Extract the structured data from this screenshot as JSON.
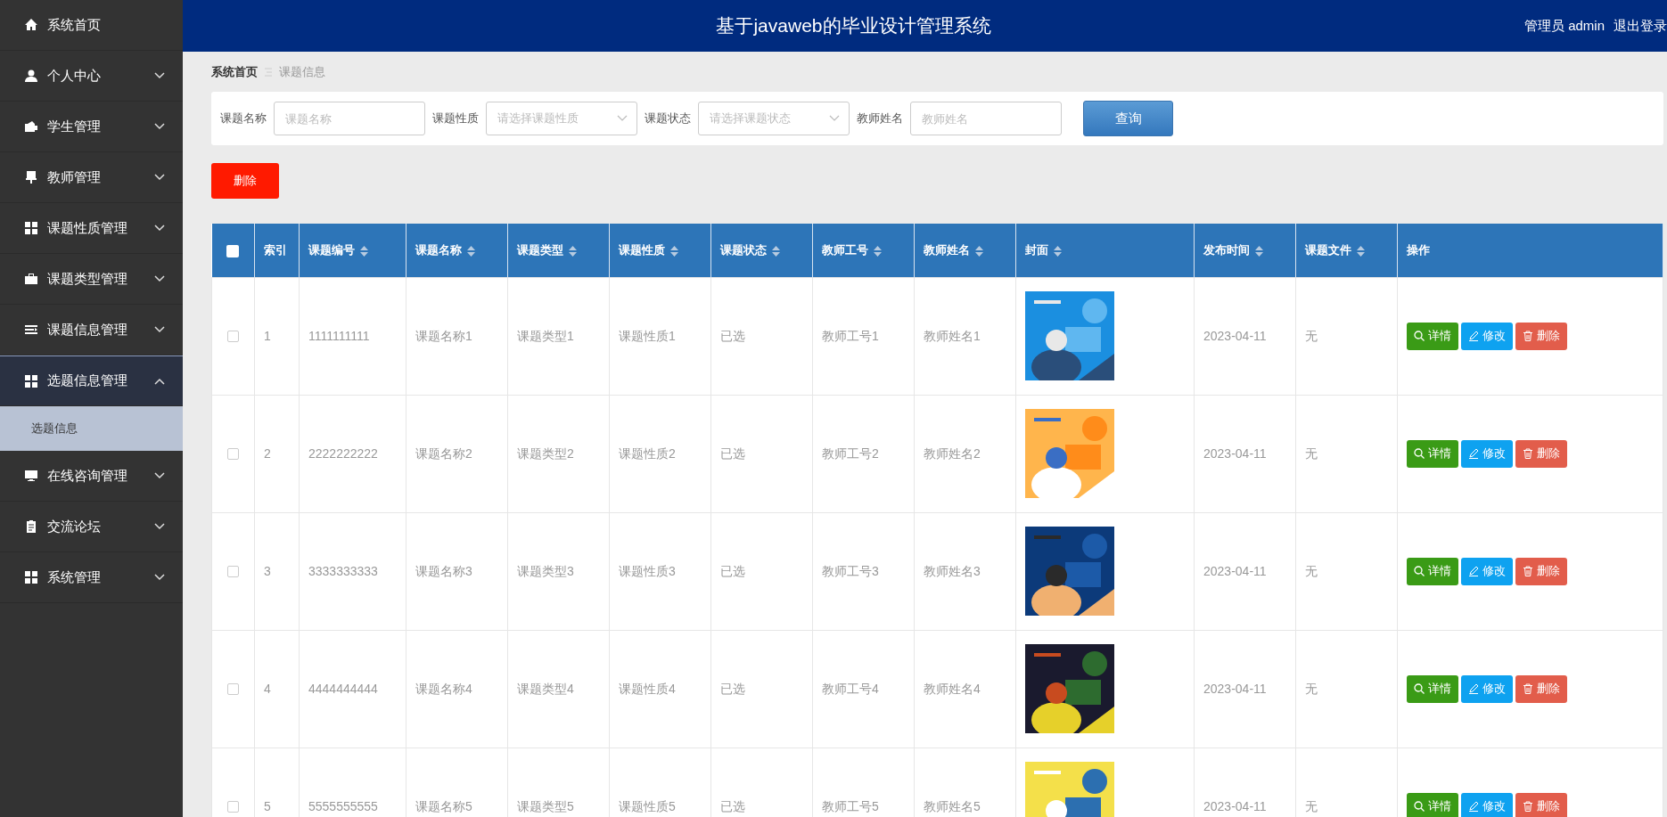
{
  "header": {
    "title": "基于javaweb的毕业设计管理系统",
    "user": "管理员 admin",
    "logout": "退出登录"
  },
  "sidebar": {
    "items": [
      {
        "label": "系统首页",
        "selected": false
      },
      {
        "label": "个人中心",
        "expanded": false,
        "selected": false
      },
      {
        "label": "学生管理",
        "expanded": false,
        "selected": false
      },
      {
        "label": "教师管理",
        "expanded": false,
        "selected": false
      },
      {
        "label": "课题性质管理",
        "expanded": false,
        "selected": false
      },
      {
        "label": "课题类型管理",
        "expanded": false,
        "selected": false
      },
      {
        "label": "课题信息管理",
        "expanded": false,
        "selected": false
      },
      {
        "label": "选题信息管理",
        "expanded": true,
        "selected": true,
        "children": [
          {
            "label": "选题信息",
            "selected": true
          }
        ]
      },
      {
        "label": "在线咨询管理",
        "expanded": false,
        "selected": false
      },
      {
        "label": "交流论坛",
        "expanded": false,
        "selected": false
      },
      {
        "label": "系统管理",
        "expanded": false,
        "selected": false
      }
    ]
  },
  "breadcrumb": [
    "系统首页",
    "课题信息"
  ],
  "search": {
    "fields": [
      {
        "label": "课题名称",
        "kind": "input",
        "placeholder": "课题名称"
      },
      {
        "label": "课题性质",
        "kind": "select",
        "placeholder": "请选择课题性质"
      },
      {
        "label": "课题状态",
        "kind": "select",
        "placeholder": "请选择课题状态"
      },
      {
        "label": "教师姓名",
        "kind": "input",
        "placeholder": "教师姓名"
      }
    ],
    "button": "查询"
  },
  "delete_button": "删除",
  "table": {
    "select_all_checked": false,
    "columns": [
      {
        "label": "索引",
        "sortable": false
      },
      {
        "label": "课题编号",
        "sortable": true
      },
      {
        "label": "课题名称",
        "sortable": true
      },
      {
        "label": "课题类型",
        "sortable": true
      },
      {
        "label": "课题性质",
        "sortable": true
      },
      {
        "label": "课题状态",
        "sortable": true
      },
      {
        "label": "教师工号",
        "sortable": true
      },
      {
        "label": "教师姓名",
        "sortable": true
      },
      {
        "label": "封面",
        "sortable": true
      },
      {
        "label": "发布时间",
        "sortable": true
      },
      {
        "label": "课题文件",
        "sortable": true
      },
      {
        "label": "操作",
        "sortable": false
      }
    ],
    "rows": [
      {
        "checked": false,
        "cells": [
          "1",
          "1111111111",
          "课题名称1",
          "课题类型1",
          "课题性质1",
          "已选",
          "教师工号1",
          "教师姓名1",
          {
            "kind": "picture"
          },
          "2023-04-11",
          "无"
        ],
        "actions": [
          "详情",
          "修改",
          "删除"
        ]
      },
      {
        "checked": false,
        "cells": [
          "2",
          "2222222222",
          "课题名称2",
          "课题类型2",
          "课题性质2",
          "已选",
          "教师工号2",
          "教师姓名2",
          {
            "kind": "picture"
          },
          "2023-04-11",
          "无"
        ],
        "actions": [
          "详情",
          "修改",
          "删除"
        ]
      },
      {
        "checked": false,
        "cells": [
          "3",
          "3333333333",
          "课题名称3",
          "课题类型3",
          "课题性质3",
          "已选",
          "教师工号3",
          "教师姓名3",
          {
            "kind": "picture"
          },
          "2023-04-11",
          "无"
        ],
        "actions": [
          "详情",
          "修改",
          "删除"
        ]
      },
      {
        "checked": false,
        "cells": [
          "4",
          "4444444444",
          "课题名称4",
          "课题类型4",
          "课题性质4",
          "已选",
          "教师工号4",
          "教师姓名4",
          {
            "kind": "picture"
          },
          "2023-04-11",
          "无"
        ],
        "actions": [
          "详情",
          "修改",
          "删除"
        ]
      },
      {
        "checked": false,
        "cells": [
          "5",
          "5555555555",
          "课题名称5",
          "课题类型5",
          "课题性质5",
          "已选",
          "教师工号5",
          "教师姓名5",
          {
            "kind": "picture"
          },
          "2023-04-11",
          "无"
        ],
        "actions": [
          "详情",
          "修改",
          "删除"
        ]
      }
    ]
  }
}
